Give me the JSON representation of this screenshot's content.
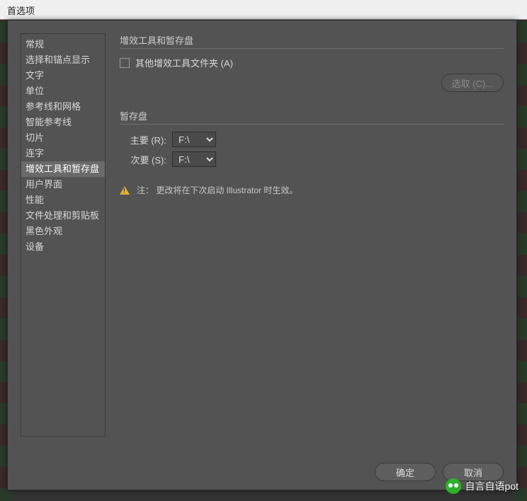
{
  "titlebar": {
    "title": "首选项"
  },
  "sidebar": {
    "items": [
      {
        "label": "常规"
      },
      {
        "label": "选择和锚点显示"
      },
      {
        "label": "文字"
      },
      {
        "label": "单位"
      },
      {
        "label": "参考线和网格"
      },
      {
        "label": "智能参考线"
      },
      {
        "label": "切片"
      },
      {
        "label": "连字"
      },
      {
        "label": "增效工具和暂存盘",
        "selected": true
      },
      {
        "label": "用户界面"
      },
      {
        "label": "性能"
      },
      {
        "label": "文件处理和剪贴板"
      },
      {
        "label": "黑色外观"
      },
      {
        "label": "设备"
      }
    ]
  },
  "section_plugins": {
    "title": "增效工具和暂存盘",
    "checkbox_label": "其他增效工具文件夹 (A)",
    "choose_btn": "选取 (C)..."
  },
  "section_scratch": {
    "title": "暂存盘",
    "primary_label": "主要 (R):",
    "secondary_label": "次要 (S):",
    "primary_value": "F:\\",
    "secondary_value": "F:\\",
    "options": [
      "F:\\"
    ]
  },
  "note": "注： 更改将在下次启动 Illustrator 时生效。",
  "footer": {
    "ok": "确定",
    "cancel": "取消"
  },
  "watermark": "自言自语pot",
  "bottom_status": ""
}
